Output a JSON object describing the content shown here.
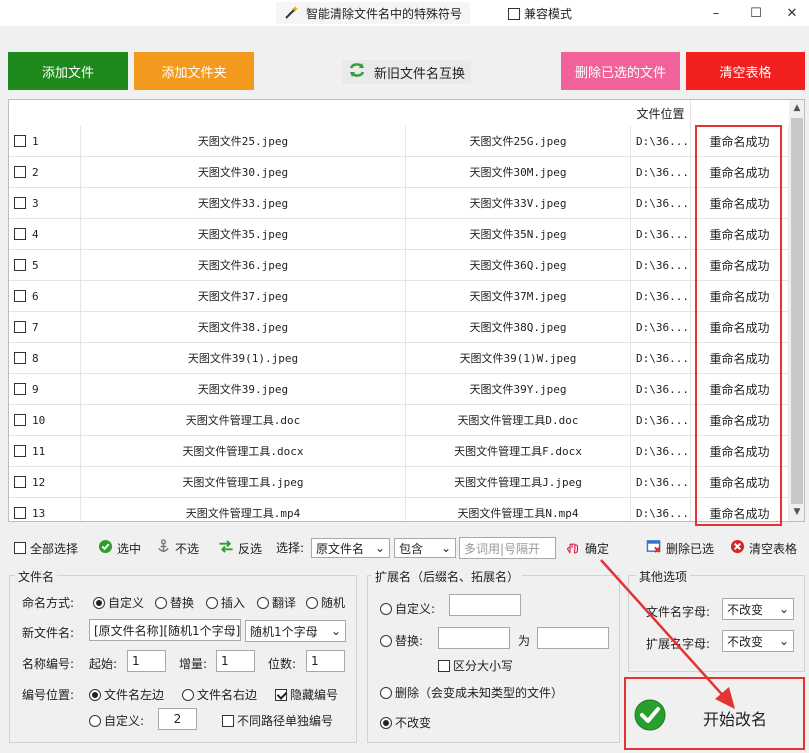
{
  "title": "智能清除文件名中的特殊符号",
  "compat_mode": "兼容模式",
  "window": {
    "min": "–",
    "max": "☐",
    "close": "✕"
  },
  "toolbar": {
    "add_file": "添加文件",
    "add_folder": "添加文件夹",
    "swap_names": "新旧文件名互换",
    "delete_selected": "删除已选的文件",
    "clear_table": "清空表格"
  },
  "colors": {
    "green": "#1e8a1e",
    "orange": "#f39a1e",
    "pink": "#f2629a",
    "red": "#f21f1f"
  },
  "table": {
    "header_location": "文件位置",
    "rows": [
      {
        "num": "1",
        "old": "天图文件25.jpeg",
        "new": "天图文件25G.jpeg",
        "loc": "D:\\36...",
        "status": "重命名成功"
      },
      {
        "num": "2",
        "old": "天图文件30.jpeg",
        "new": "天图文件30M.jpeg",
        "loc": "D:\\36...",
        "status": "重命名成功"
      },
      {
        "num": "3",
        "old": "天图文件33.jpeg",
        "new": "天图文件33V.jpeg",
        "loc": "D:\\36...",
        "status": "重命名成功"
      },
      {
        "num": "4",
        "old": "天图文件35.jpeg",
        "new": "天图文件35N.jpeg",
        "loc": "D:\\36...",
        "status": "重命名成功"
      },
      {
        "num": "5",
        "old": "天图文件36.jpeg",
        "new": "天图文件36Q.jpeg",
        "loc": "D:\\36...",
        "status": "重命名成功"
      },
      {
        "num": "6",
        "old": "天图文件37.jpeg",
        "new": "天图文件37M.jpeg",
        "loc": "D:\\36...",
        "status": "重命名成功"
      },
      {
        "num": "7",
        "old": "天图文件38.jpeg",
        "new": "天图文件38Q.jpeg",
        "loc": "D:\\36...",
        "status": "重命名成功"
      },
      {
        "num": "8",
        "old": "天图文件39(1).jpeg",
        "new": "天图文件39(1)W.jpeg",
        "loc": "D:\\36...",
        "status": "重命名成功"
      },
      {
        "num": "9",
        "old": "天图文件39.jpeg",
        "new": "天图文件39Y.jpeg",
        "loc": "D:\\36...",
        "status": "重命名成功"
      },
      {
        "num": "10",
        "old": "天图文件管理工具.doc",
        "new": "天图文件管理工具D.doc",
        "loc": "D:\\36...",
        "status": "重命名成功"
      },
      {
        "num": "11",
        "old": "天图文件管理工具.docx",
        "new": "天图文件管理工具F.docx",
        "loc": "D:\\36...",
        "status": "重命名成功"
      },
      {
        "num": "12",
        "old": "天图文件管理工具.jpeg",
        "new": "天图文件管理工具J.jpeg",
        "loc": "D:\\36...",
        "status": "重命名成功"
      },
      {
        "num": "13",
        "old": "天图文件管理工具.mp4",
        "new": "天图文件管理工具N.mp4",
        "loc": "D:\\36...",
        "status": "重命名成功"
      }
    ]
  },
  "selection": {
    "select_all": "全部选择",
    "select": "选中",
    "deselect": "不选",
    "invert": "反选",
    "choose_label": "选择:",
    "field_value": "原文件名",
    "match_value": "包含",
    "keyword_placeholder": "多词用|号隔开",
    "confirm": "确定",
    "delete_selected": "删除已选",
    "clear_table": "清空表格"
  },
  "filename_group": {
    "title": "文件名",
    "naming_label": "命名方式:",
    "naming_options": [
      "自定义",
      "替换",
      "插入",
      "翻译",
      "随机"
    ],
    "new_name_label": "新文件名:",
    "new_name_value": "[原文件名称][随机1个字母]",
    "random_select": "随机1个字母",
    "number_label": "名称编号:",
    "start_label": "起始:",
    "start_value": "1",
    "step_label": "增量:",
    "step_value": "1",
    "digits_label": "位数:",
    "digits_value": "1",
    "position_label": "编号位置:",
    "pos_left": "文件名左边",
    "pos_right": "文件名右边",
    "hide_number": "隐藏编号",
    "custom": "自定义:",
    "custom_value": "2",
    "per_path": "不同路径单独编号"
  },
  "ext_group": {
    "title": "扩展名（后缀名、拓展名）",
    "custom": "自定义:",
    "replace": "替换:",
    "to": "为",
    "case_sensitive": "区分大小写",
    "delete": "删除（会变成未知类型的文件）",
    "no_change": "不改变"
  },
  "other_group": {
    "title": "其他选项",
    "filename_case_label": "文件名字母:",
    "filename_case_value": "不改变",
    "ext_case_label": "扩展名字母:",
    "ext_case_value": "不改变"
  },
  "start_button": "开始改名"
}
